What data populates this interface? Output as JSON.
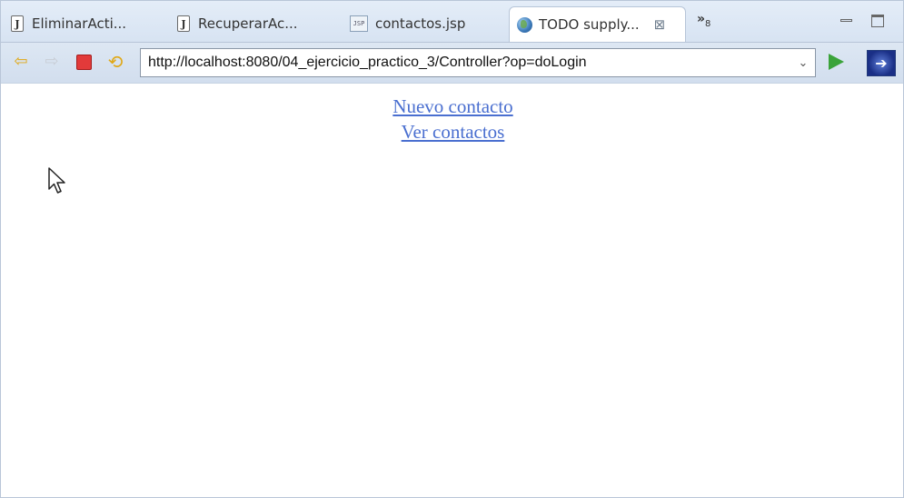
{
  "tabs": [
    {
      "label": "EliminarActi...",
      "icon": "java-file-icon"
    },
    {
      "label": "RecuperarAc...",
      "icon": "java-file-icon"
    },
    {
      "label": "contactos.jsp",
      "icon": "jsp-file-icon"
    },
    {
      "label": "TODO supply...",
      "icon": "globe-icon",
      "active": true
    }
  ],
  "overflow": {
    "glyph": "»",
    "count": "8"
  },
  "toolbar": {
    "url": "http://localhost:8080/04_ejercicio_practico_3/Controller?op=doLogin"
  },
  "content": {
    "links": [
      "Nuevo contacto",
      "Ver contactos"
    ]
  },
  "colors": {
    "link": "#4a6fd0",
    "chrome": "#d7e3f2"
  }
}
